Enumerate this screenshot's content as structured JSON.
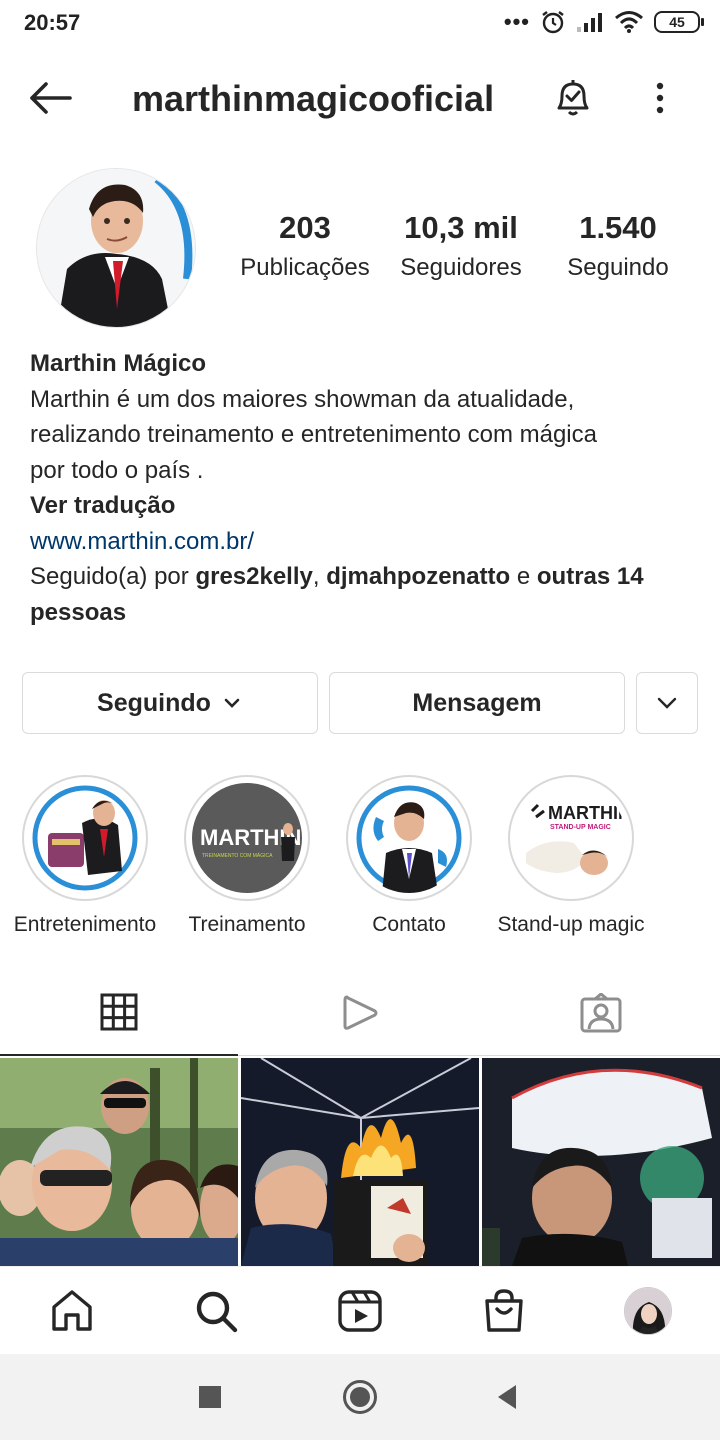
{
  "status_bar": {
    "time": "20:57",
    "battery": "45",
    "dots": "•••"
  },
  "header": {
    "username": "marthinmagicooficial"
  },
  "stats": [
    {
      "value": "203",
      "label": "Publicações"
    },
    {
      "value": "10,3 mil",
      "label": "Seguidores"
    },
    {
      "value": "1.540",
      "label": "Seguindo"
    }
  ],
  "bio": {
    "name": "Marthin Mágico",
    "line1": "Marthin é um dos maiores showman da atualidade,",
    "line2": "realizando treinamento e entretenimento com mágica",
    "line3": "por todo o país .",
    "translate": "Ver tradução",
    "link": "www.marthin.com.br/",
    "followed_prefix": "Seguido(a) por ",
    "follower1": "gres2kelly",
    "comma": ", ",
    "follower2": "djmahpozenatto",
    "and": " e ",
    "others_1": "outras 14",
    "others_2": "pessoas"
  },
  "buttons": {
    "following": "Seguindo",
    "message": "Mensagem"
  },
  "highlights": [
    {
      "caption": "Entretenimento",
      "logo_text": ""
    },
    {
      "caption": "Treinamento",
      "logo_text": "MARTHIN",
      "logo_sub": "TREINAMENTO COM MÁGICA"
    },
    {
      "caption": "Contato",
      "logo_text": ""
    },
    {
      "caption": "Stand-up magic",
      "logo_text": "MARTHIN",
      "logo_sub": "STAND-UP MAGIC"
    }
  ],
  "icons": {
    "grid_tab": "grid-icon",
    "reels_tab": "play-icon",
    "tagged_tab": "tagged-person-icon",
    "home": "home-icon",
    "search": "search-icon",
    "reels": "reels-icon",
    "shop": "shopping-bag-icon"
  },
  "colors": {
    "link": "#00376b",
    "border": "#dbdbdb",
    "text": "#262626"
  }
}
